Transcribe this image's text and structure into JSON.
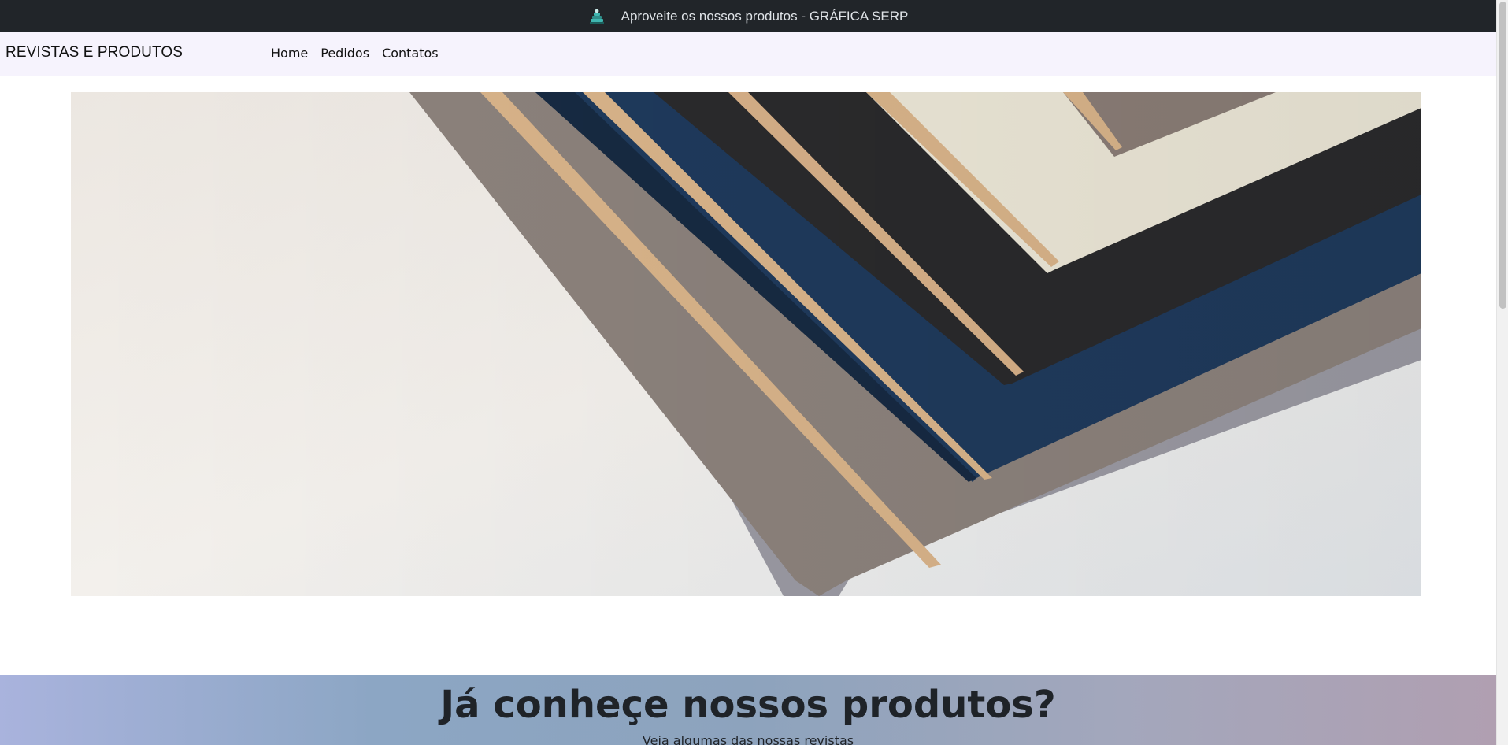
{
  "topbar": {
    "logo_icon": "book-stack-icon",
    "text": "Aproveite os nossos produtos - GRÁFICA SERP"
  },
  "navbar": {
    "brand": "REVISTAS E PRODUTOS",
    "links": [
      "Home",
      "Pedidos",
      "Contatos"
    ]
  },
  "hero": {
    "image": "stacked-notebook-covers-photo"
  },
  "products_section": {
    "heading": "Já conheçe nossos produtos?",
    "subtext": "Veja algumas das nossas revistas"
  },
  "colors": {
    "topbar_bg": "#212529",
    "navbar_bg": "#f6f3fd",
    "section_gradient": [
      "#a9b3dd",
      "#8ca6c4",
      "#b09fb1"
    ]
  }
}
